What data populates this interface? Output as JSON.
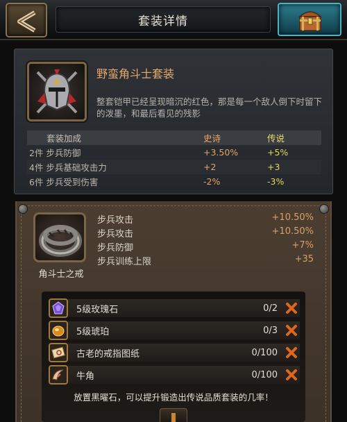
{
  "header": {
    "title": "套装详情"
  },
  "set": {
    "name": "野蛮角斗士套装",
    "description": "整套铠甲已经呈现暗沉的红色，那是每一个敌人倒下时留下的泼墨，和最后看见的残影",
    "bonus_table": {
      "headers": {
        "name": "套装加成",
        "epic": "史诗",
        "legendary": "传说"
      },
      "rows": [
        {
          "name": "2件 步兵防御",
          "epic": "+3.50%",
          "legendary": "+5%"
        },
        {
          "name": "4件 步兵基础攻击力",
          "epic": "+2",
          "legendary": "+3"
        },
        {
          "name": "6件 步兵受到伤害",
          "epic": "-2%",
          "legendary": "-3%"
        }
      ]
    }
  },
  "item": {
    "name": "角斗士之戒",
    "icon": "ring-icon",
    "stats": [
      {
        "label": "步兵攻击",
        "value": "+10.50%"
      },
      {
        "label": "步兵攻击",
        "value": "+10.50%"
      },
      {
        "label": "步兵防御",
        "value": "+7%"
      },
      {
        "label": "步兵训练上限",
        "value": "+35"
      }
    ]
  },
  "materials": [
    {
      "name": "5级玫瑰石",
      "count": "0/2",
      "icon": "purple-gem-icon"
    },
    {
      "name": "5级琥珀",
      "count": "0/3",
      "icon": "amber-icon"
    },
    {
      "name": "古老的戒指图纸",
      "count": "0/100",
      "icon": "blueprint-scroll-icon"
    },
    {
      "name": "牛角",
      "count": "0/100",
      "icon": "horn-icon"
    }
  ],
  "hint": "放置黑曜石，可以提升锻造出传说品质套装的几率！",
  "colors": {
    "epic": "#e8a46a",
    "legendary": "#e6d95a",
    "set_name": "#e6a96c",
    "missing_x": "#e0681e"
  }
}
